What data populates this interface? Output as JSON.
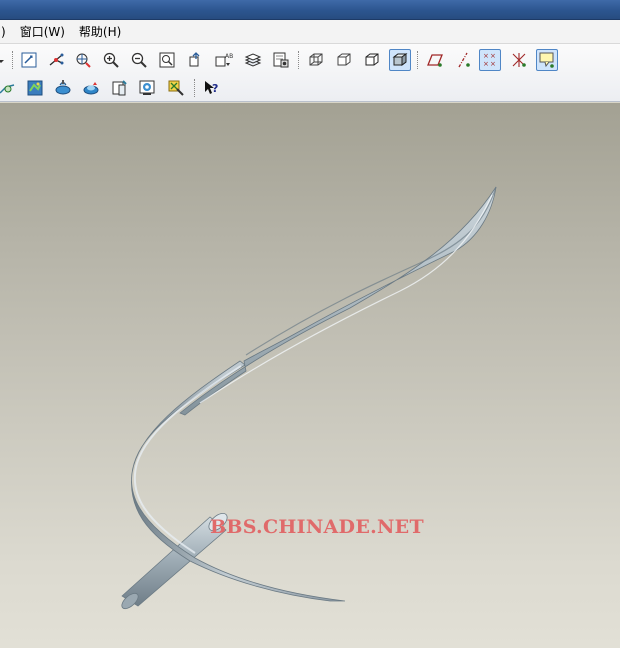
{
  "window": {
    "menu": [
      {
        "id": "partial",
        "label": ")"
      },
      {
        "id": "window",
        "label": "窗口(W)"
      },
      {
        "id": "help",
        "label": "帮助(H)"
      }
    ]
  },
  "toolbar_row1": [
    "dropdown-arrow-icon",
    "redraw-icon",
    "spin-center-icon",
    "orient-mode-icon",
    "zoom-in-icon",
    "zoom-out-icon",
    "refit-icon",
    "reorient-icon",
    "saved-views-icon",
    "layers-icon",
    "setup-icon",
    "wireframe-icon",
    "hidden-line-icon",
    "no-hidden-icon",
    "shading-icon",
    "datum-planes-icon",
    "datum-axes-icon",
    "datum-points-icon",
    "coordinate-systems-icon",
    "annotations-icon"
  ],
  "toolbar_row2": [
    "sketch-tool-icon",
    "appearance-icon",
    "render-icon",
    "environment-icon",
    "model-tree-icon",
    "view-manager-icon",
    "repaint-icon",
    "whats-this-icon"
  ],
  "toolbar_active": [
    "shading-icon",
    "datum-points-icon",
    "annotations-icon"
  ],
  "colors": {
    "model_light": "#dfe6ea",
    "model_mid": "#aab7bf",
    "model_dark": "#6e7e88",
    "accent_blue": "#2c558f",
    "watermark": "#e06a6a"
  },
  "watermark": "BBS.CHINADE.NET"
}
